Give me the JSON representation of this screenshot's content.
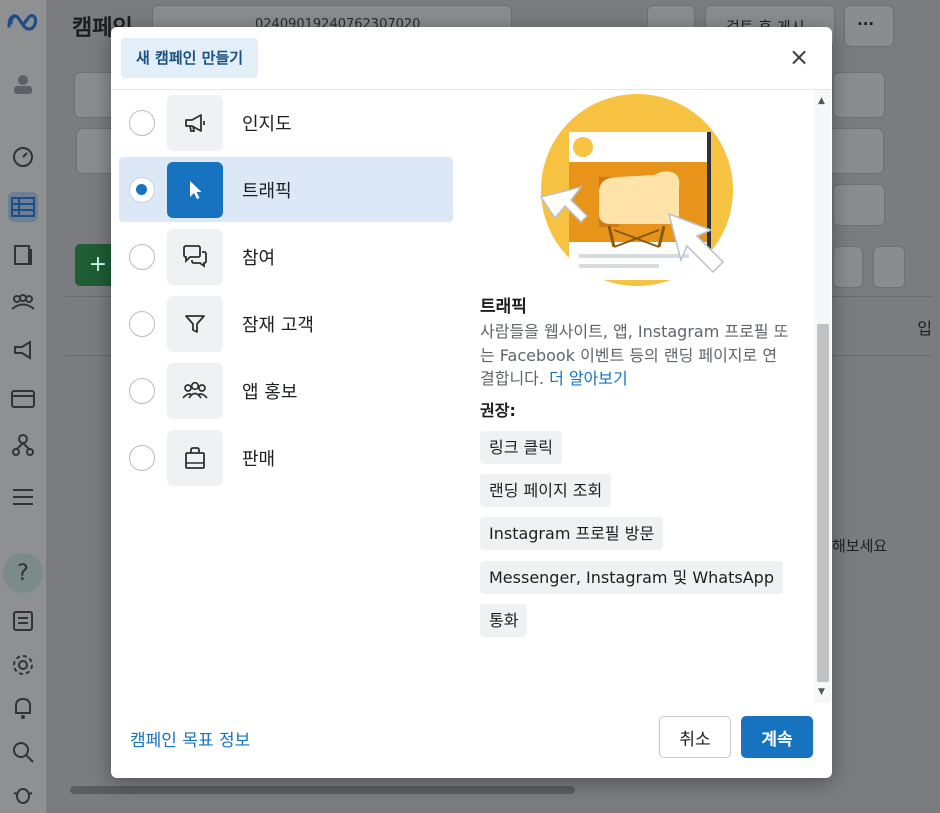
{
  "background": {
    "page_title": "캠페인",
    "account_id": "02409019240762307020",
    "review_button": "검토 후 게시",
    "more_button": "···",
    "right_hint": "해보세요",
    "col_header": "입"
  },
  "modal": {
    "title": "새 캠페인 만들기",
    "close_icon": "×",
    "objectives": [
      {
        "label": "인지도",
        "icon": "megaphone-icon",
        "selected": false
      },
      {
        "label": "트래픽",
        "icon": "cursor-icon",
        "selected": true
      },
      {
        "label": "참여",
        "icon": "chat-bubbles-icon",
        "selected": false
      },
      {
        "label": "잠재 고객",
        "icon": "funnel-icon",
        "selected": false
      },
      {
        "label": "앱 홍보",
        "icon": "people-group-icon",
        "selected": false
      },
      {
        "label": "판매",
        "icon": "shopping-bag-icon",
        "selected": false
      }
    ],
    "detail": {
      "title": "트래픽",
      "description": "사람들을 웹사이트, 앱, Instagram 프로필 또는 Facebook 이벤트 등의 랜딩 페이지로 연결합니다.",
      "learn_more": "더 알아보기",
      "recommended_label": "권장:",
      "tags": [
        "링크 클릭",
        "랜딩 페이지 조회",
        "Instagram 프로필 방문",
        "Messenger, Instagram 및 WhatsApp",
        "통화"
      ]
    },
    "footer": {
      "about_link": "캠페인 목표 정보",
      "cancel": "취소",
      "continue": "계속"
    }
  },
  "colors": {
    "accent": "#1773c0",
    "selected_bg": "#dce8f5",
    "illustration_yellow": "#f7c242",
    "illustration_orange": "#e8941a"
  }
}
